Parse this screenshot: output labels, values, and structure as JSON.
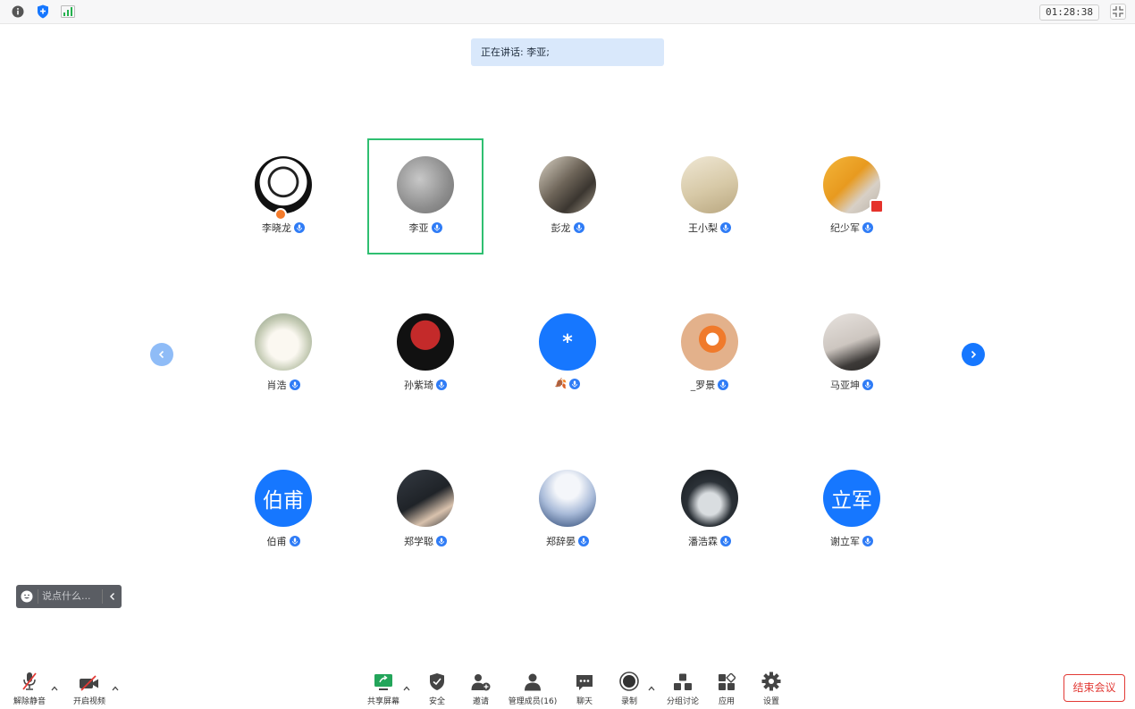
{
  "topbar": {
    "icons": [
      "info-icon",
      "shield-icon",
      "signal-icon"
    ],
    "timer": "01:28:38"
  },
  "speaking": "正在讲话: 李亚;",
  "participants": [
    {
      "name": "李晓龙",
      "avatar": "panda-photo"
    },
    {
      "name": "李亚",
      "avatar": "calligraphy-photo",
      "active": true
    },
    {
      "name": "彭龙",
      "avatar": "wolves-photo"
    },
    {
      "name": "王小梨",
      "avatar": "girl-photo"
    },
    {
      "name": "纪少军",
      "avatar": "yellow-jacket-photo"
    },
    {
      "name": "肖浩",
      "avatar": "bunny-photo"
    },
    {
      "name": "孙紫琦",
      "avatar": "uchiha-fan-photo"
    },
    {
      "name": "🍂",
      "avatar_text": "*",
      "avatar_color": "#1677ff"
    },
    {
      "name": "_罗景",
      "avatar": "fish-photo"
    },
    {
      "name": "马亚坤",
      "avatar": "birds-photo"
    },
    {
      "name": "伯甫",
      "avatar_text": "伯甫",
      "avatar_color": "#1677ff"
    },
    {
      "name": "郑学聪",
      "avatar": "boy-photo"
    },
    {
      "name": "郑辞晏",
      "avatar": "silhouette-photo"
    },
    {
      "name": "潘浩霖",
      "avatar": "anime-boy-photo"
    },
    {
      "name": "谢立军",
      "avatar_text": "立军",
      "avatar_color": "#1677ff"
    }
  ],
  "chat": {
    "placeholder": "说点什么..."
  },
  "toolbar": {
    "unmute": "解除静音",
    "start_video": "开启视频",
    "share_screen": "共享屏幕",
    "security": "安全",
    "invite": "邀请",
    "manage_members": "管理成员(16)",
    "chat": "聊天",
    "record": "录制",
    "breakout": "分组讨论",
    "apps": "应用",
    "settings": "设置",
    "end_meeting": "结束会议"
  },
  "colors": {
    "accent": "#1677ff",
    "active_border": "#2fbf71",
    "end": "#e23a35"
  }
}
